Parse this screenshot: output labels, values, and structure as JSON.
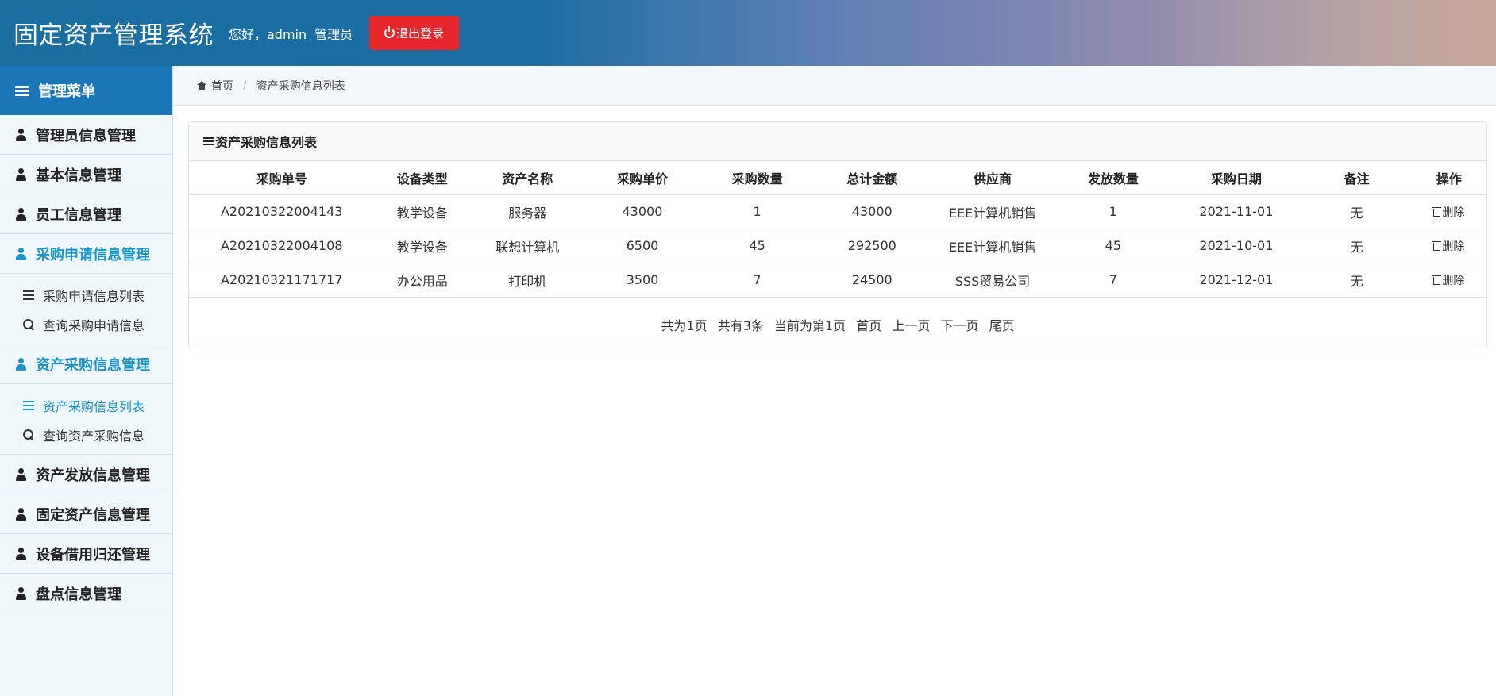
{
  "header": {
    "title": "固定资产管理系统",
    "greeting": "您好，admin",
    "role": "管理员",
    "logout_label": "退出登录"
  },
  "sidebar": {
    "menu_title": "管理菜单",
    "items": [
      {
        "label": "管理员信息管理"
      },
      {
        "label": "基本信息管理"
      },
      {
        "label": "员工信息管理"
      },
      {
        "label": "采购申请信息管理",
        "sub": [
          "采购申请信息列表",
          "查询采购申请信息"
        ]
      },
      {
        "label": "资产采购信息管理",
        "sub": [
          "资产采购信息列表",
          "查询资产采购信息"
        ]
      },
      {
        "label": "资产发放信息管理"
      },
      {
        "label": "固定资产信息管理"
      },
      {
        "label": "设备借用归还管理"
      },
      {
        "label": "盘点信息管理"
      }
    ]
  },
  "breadcrumb": {
    "home": "首页",
    "current": "资产采购信息列表"
  },
  "panel": {
    "title": "资产采购信息列表"
  },
  "table": {
    "headers": [
      "采购单号",
      "设备类型",
      "资产名称",
      "采购单价",
      "采购数量",
      "总计金额",
      "供应商",
      "发放数量",
      "采购日期",
      "备注",
      "操作"
    ],
    "rows": [
      [
        "A20210322004143",
        "教学设备",
        "服务器",
        "43000",
        "1",
        "43000",
        "EEE计算机销售",
        "1",
        "2021-11-01",
        "无",
        "删除"
      ],
      [
        "A20210322004108",
        "教学设备",
        "联想计算机",
        "6500",
        "45",
        "292500",
        "EEE计算机销售",
        "45",
        "2021-10-01",
        "无",
        "删除"
      ],
      [
        "A20210321171717",
        "办公用品",
        "打印机",
        "3500",
        "7",
        "24500",
        "SSS贸易公司",
        "7",
        "2021-12-01",
        "无",
        "删除"
      ]
    ]
  },
  "pager": {
    "total_pages": "共为1页",
    "total_items": "共有3条",
    "current": "当前为第1页",
    "first": "首页",
    "prev": "上一页",
    "next": "下一页",
    "last": "尾页"
  }
}
